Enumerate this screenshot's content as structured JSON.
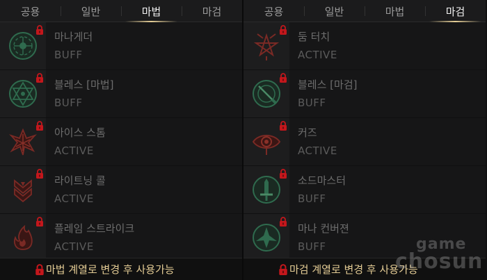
{
  "left_panel": {
    "tabs": [
      {
        "label": "공용",
        "active": false
      },
      {
        "label": "일반",
        "active": false
      },
      {
        "label": "마법",
        "active": true
      },
      {
        "label": "마검",
        "active": false
      }
    ],
    "skills": [
      {
        "name": "마나게더",
        "type": "BUFF",
        "icon": "mana-gather-icon",
        "color": "#2f6b4e",
        "locked": true
      },
      {
        "name": "블레스 [마법]",
        "type": "BUFF",
        "icon": "hexagram-bless-icon",
        "color": "#2f6b4e",
        "locked": true
      },
      {
        "name": "아이스 스톰",
        "type": "ACTIVE",
        "icon": "ice-storm-icon",
        "color": "#7a2a25",
        "locked": true
      },
      {
        "name": "라이트닝 콜",
        "type": "ACTIVE",
        "icon": "lightning-call-icon",
        "color": "#7a2a25",
        "locked": true
      },
      {
        "name": "플레임 스트라이크",
        "type": "ACTIVE",
        "icon": "flame-strike-icon",
        "color": "#7a2a25",
        "locked": true
      }
    ],
    "footer": "마법 계열로 변경 후 사용가능"
  },
  "right_panel": {
    "tabs": [
      {
        "label": "공용",
        "active": false
      },
      {
        "label": "일반",
        "active": false
      },
      {
        "label": "마법",
        "active": false
      },
      {
        "label": "마검",
        "active": true
      }
    ],
    "skills": [
      {
        "name": "둠 터치",
        "type": "ACTIVE",
        "icon": "pentagram-doom-icon",
        "color": "#7a2a25",
        "locked": true
      },
      {
        "name": "블레스 [마검]",
        "type": "BUFF",
        "icon": "blade-bless-icon",
        "color": "#2f6b4e",
        "locked": true
      },
      {
        "name": "커즈",
        "type": "ACTIVE",
        "icon": "curse-eye-icon",
        "color": "#7a2a25",
        "locked": true
      },
      {
        "name": "소드마스터",
        "type": "BUFF",
        "icon": "sword-master-icon",
        "color": "#2f6b4e",
        "locked": true
      },
      {
        "name": "마나 컨버젼",
        "type": "BUFF",
        "icon": "mana-conversion-icon",
        "color": "#2f6b4e",
        "locked": true
      }
    ],
    "footer": "마검 계열로 변경 후 사용가능"
  },
  "watermark": {
    "line1": "game",
    "line2": "chosun"
  },
  "colors": {
    "accent_gold": "#e4cc95",
    "lock_red": "#c3171c"
  }
}
